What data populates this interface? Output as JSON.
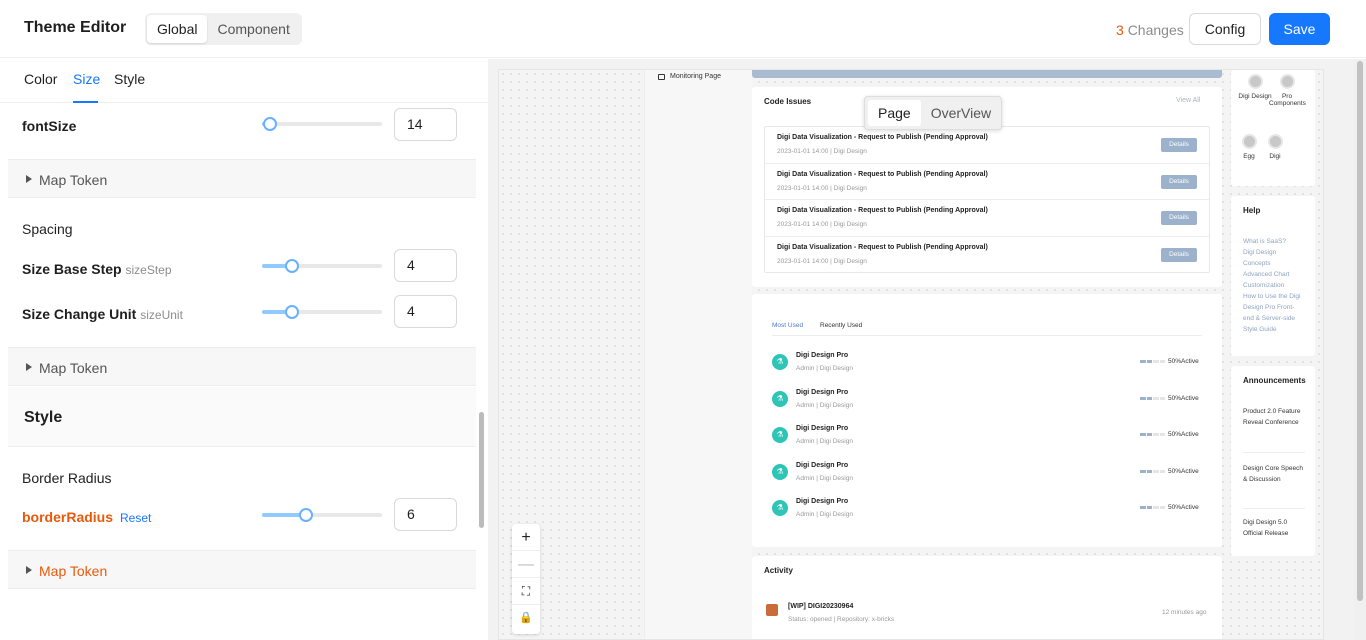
{
  "header": {
    "title": "Theme Editor",
    "mode_options": [
      "Global",
      "Component"
    ],
    "active_mode": "Global",
    "changes_count": "3",
    "changes_label": "Changes",
    "config_label": "Config",
    "save_label": "Save"
  },
  "tabs": {
    "items": [
      "Color",
      "Size",
      "Style"
    ],
    "active": "Size"
  },
  "size": {
    "font_size": {
      "label": "fontSize",
      "value": "14",
      "slider_fraction": 0.07
    },
    "map_token_label": "Map Token",
    "spacing_title": "Spacing",
    "size_step": {
      "label": "Size Base Step",
      "token": "sizeStep",
      "value": "4",
      "slider_fraction": 0.25
    },
    "size_unit": {
      "label": "Size Change Unit",
      "token": "sizeUnit",
      "value": "4",
      "slider_fraction": 0.25
    },
    "map_token_label_2": "Map Token"
  },
  "style": {
    "title": "Style",
    "border_title": "Border Radius",
    "border_radius": {
      "label": "borderRadius",
      "reset_label": "Reset",
      "value": "6",
      "slider_fraction": 0.37
    },
    "map_token_label": "Map Token"
  },
  "preview": {
    "page_toggle": [
      "Page",
      "OverView"
    ],
    "page_toggle_active": "Page",
    "monitoring_label": "Monitoring Page",
    "code_issues": {
      "title": "Code Issues",
      "view_all": "View All",
      "items": [
        {
          "title": "Digi Data Visualization - Request to Publish (Pending Approval)",
          "meta": "2023-01-01 14:00 | Digi Design",
          "action": "Details"
        },
        {
          "title": "Digi Data Visualization - Request to Publish (Pending Approval)",
          "meta": "2023-01-01 14:00 | Digi Design",
          "action": "Details"
        },
        {
          "title": "Digi Data Visualization - Request to Publish (Pending Approval)",
          "meta": "2023-01-01 14:00 | Digi Design",
          "action": "Details"
        },
        {
          "title": "Digi Data Visualization - Request to Publish (Pending Approval)",
          "meta": "2023-01-01 14:00 | Digi Design",
          "action": "Details"
        }
      ]
    },
    "projects": {
      "tabs": [
        "Most Used",
        "Recently Used"
      ],
      "active_tab": "Most Used",
      "items": [
        {
          "name": "Digi Design Pro",
          "meta": "Admin | Digi Design",
          "status": "50%Active",
          "progress": 0.5
        },
        {
          "name": "Digi Design Pro",
          "meta": "Admin | Digi Design",
          "status": "50%Active",
          "progress": 0.5
        },
        {
          "name": "Digi Design Pro",
          "meta": "Admin | Digi Design",
          "status": "50%Active",
          "progress": 0.5
        },
        {
          "name": "Digi Design Pro",
          "meta": "Admin | Digi Design",
          "status": "50%Active",
          "progress": 0.5
        },
        {
          "name": "Digi Design Pro",
          "meta": "Admin | Digi Design",
          "status": "50%Active",
          "progress": 0.5
        }
      ]
    },
    "activity": {
      "title": "Activity",
      "item": {
        "title": "[WIP] DIGI20230964",
        "meta": "Status: opened | Repository: x-bricks",
        "time": "12 minutes ago"
      }
    },
    "quick_links": {
      "items": [
        "Digi Design",
        "Pro Components",
        "Egg",
        "Digi"
      ]
    },
    "help": {
      "title": "Help",
      "links": [
        "What is SaaS?",
        "Digi Design Concepts",
        "Advanced Chart Customization",
        "How to Use the Digi Design Pro Front-end & Server-side Style Guide"
      ]
    },
    "announcements": {
      "title": "Announcements",
      "items": [
        "Product 2.0 Feature Reveal Conference",
        "Design Core Speech & Discussion",
        "Digi Design 5.0 Official Release"
      ]
    },
    "zoom_controls": [
      "+",
      "—"
    ]
  },
  "colors": {
    "accent": "#1677ff",
    "changed": "#e8590c",
    "teal": "#2ec4b6"
  }
}
